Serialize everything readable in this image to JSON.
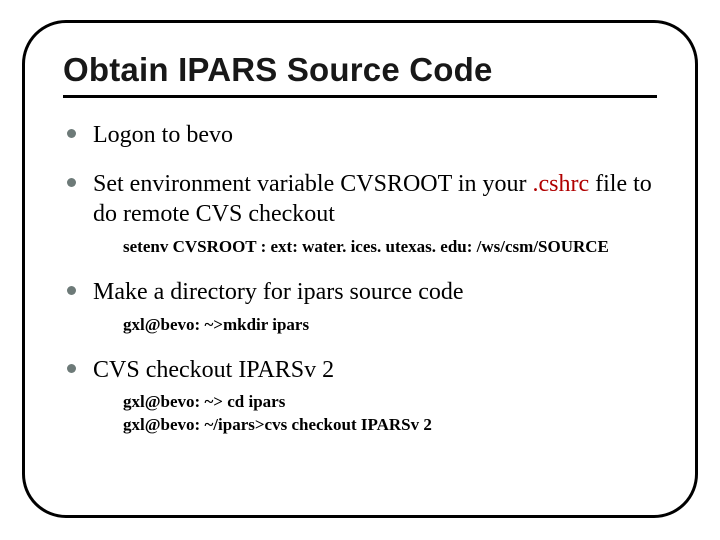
{
  "title": "Obtain IPARS Source Code",
  "bullets": [
    {
      "text": "Logon to bevo"
    },
    {
      "pre": "Set environment variable CVSROOT in your ",
      "red": ".cshrc",
      "post": " file to do remote CVS checkout",
      "cmd": "setenv CVSROOT : ext: water. ices. utexas. edu: /ws/csm/SOURCE"
    },
    {
      "text": "Make a directory for ipars source code",
      "cmd": "gxl@bevo: ~>mkdir ipars"
    },
    {
      "text": "CVS checkout IPARSv 2",
      "cmd": "gxl@bevo: ~> cd ipars\ngxl@bevo: ~/ipars>cvs checkout IPARSv 2"
    }
  ]
}
